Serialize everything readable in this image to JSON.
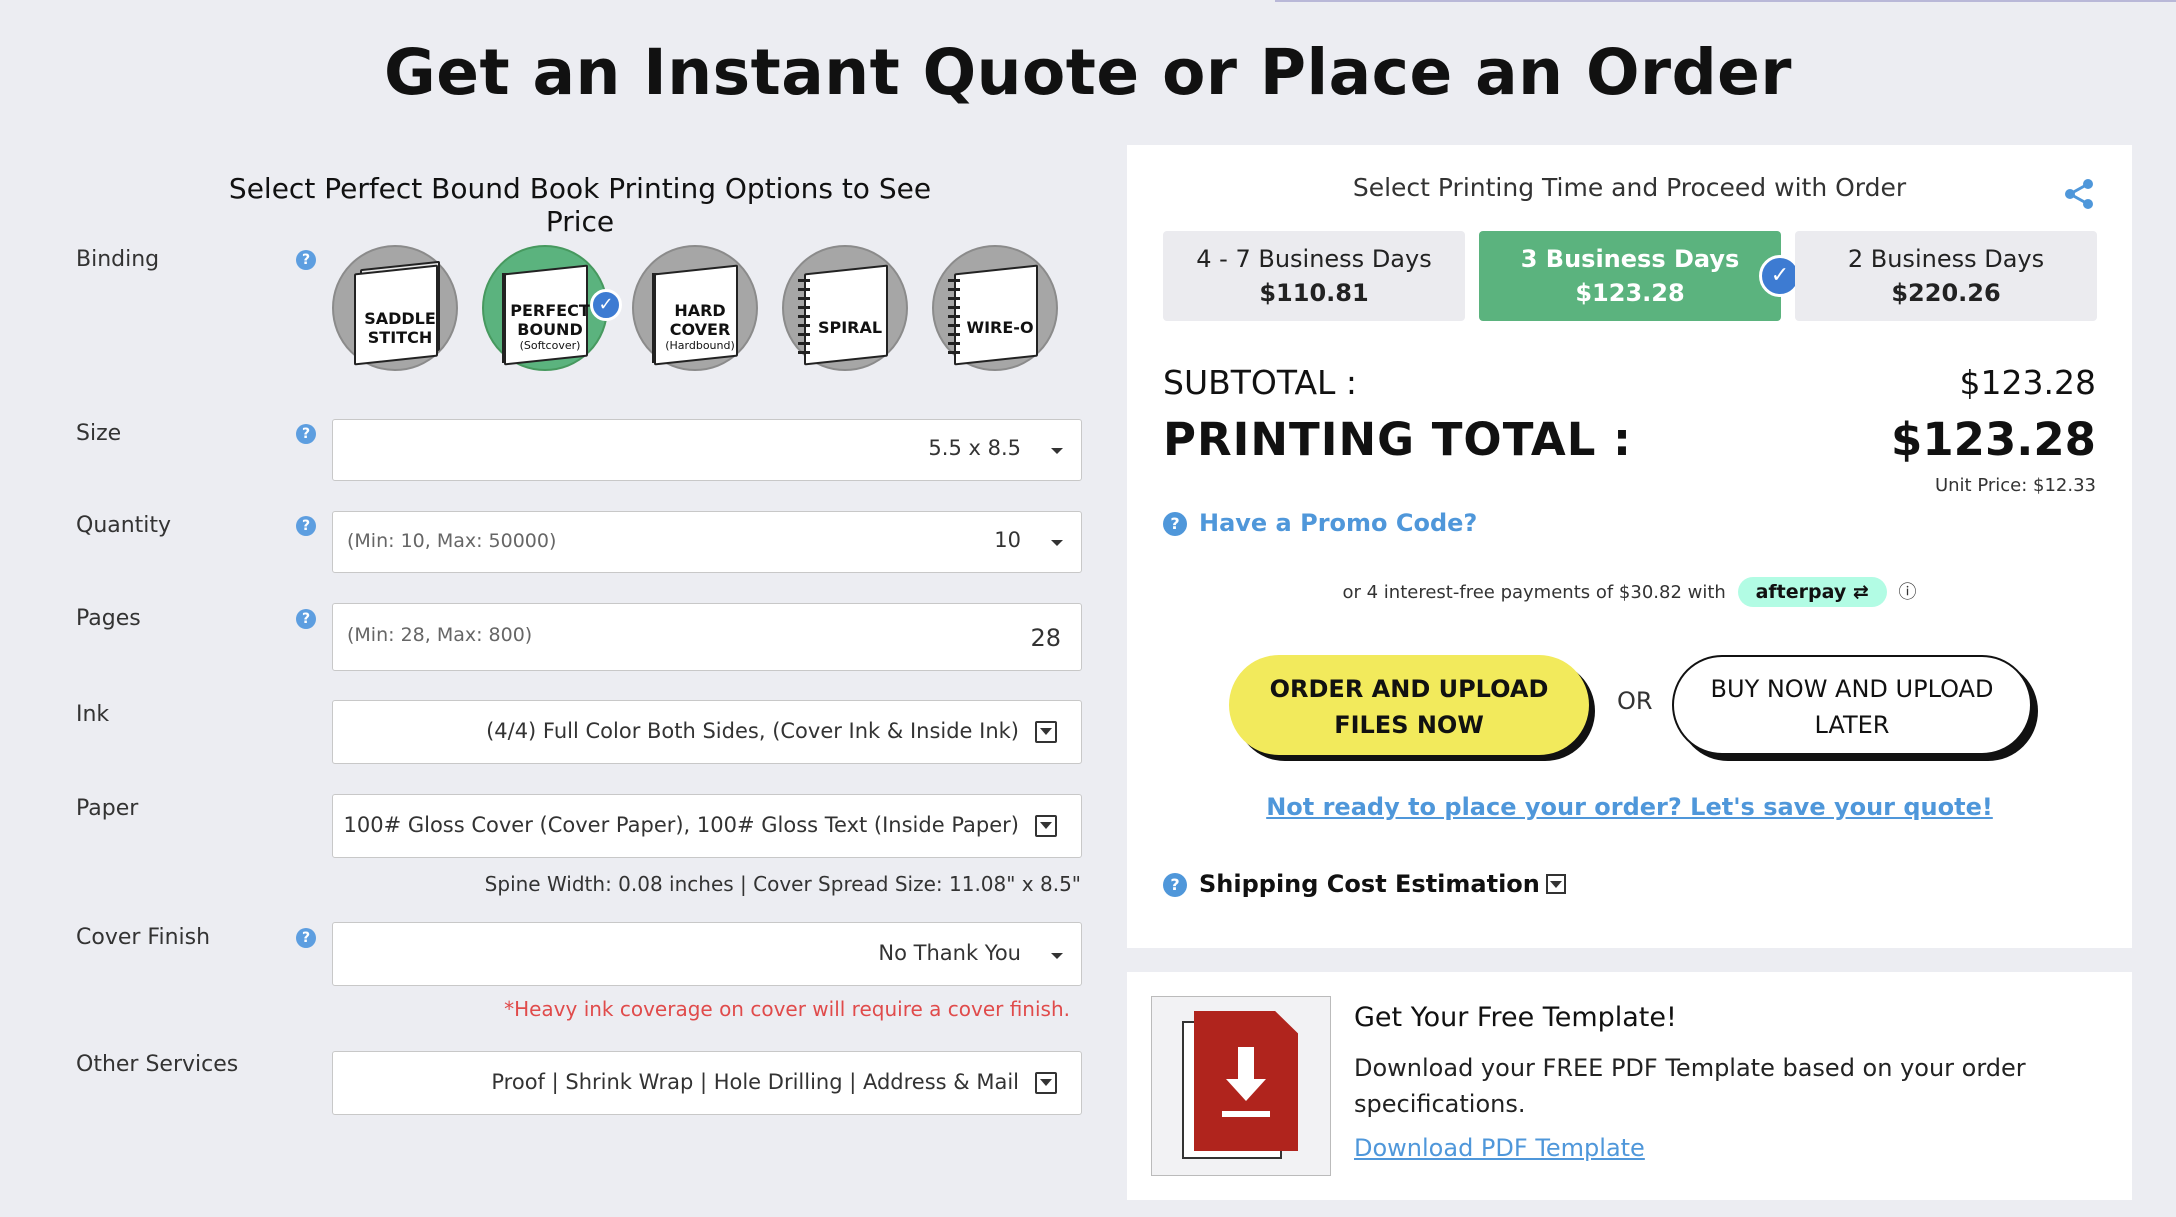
{
  "page_title": "Get an Instant Quote or Place an Order",
  "left": {
    "subtitle": "Select Perfect Bound Book Printing Options to See Price",
    "labels": {
      "binding": "Binding",
      "size": "Size",
      "quantity": "Quantity",
      "pages": "Pages",
      "ink": "Ink",
      "paper": "Paper",
      "cover_finish": "Cover Finish",
      "other_services": "Other Services"
    },
    "binding_options": [
      {
        "line1": "SADDLE",
        "line2": "STITCH",
        "small": ""
      },
      {
        "line1": "PERFECT",
        "line2": "BOUND",
        "small": "(Softcover)"
      },
      {
        "line1": "HARD",
        "line2": "COVER",
        "small": "(Hardbound)"
      },
      {
        "line1": "SPIRAL",
        "line2": "",
        "small": ""
      },
      {
        "line1": "WIRE-O",
        "line2": "",
        "small": ""
      }
    ],
    "selected_binding": "PERFECT BOUND",
    "size_value": "5.5 x 8.5",
    "quantity_placeholder": "(Min: 10, Max: 50000)",
    "quantity_value": "10",
    "pages_placeholder": "(Min: 28, Max: 800)",
    "pages_value": "28",
    "ink_value": "(4/4) Full Color Both Sides, (Cover Ink & Inside Ink)",
    "paper_value": "100# Gloss Cover (Cover Paper), 100# Gloss Text (Inside Paper)",
    "spine_info": "Spine Width: 0.08 inches | Cover Spread Size: 11.08\" x 8.5\"",
    "cover_finish_value": "No Thank You",
    "cover_finish_warning": "*Heavy ink coverage on cover will require a cover finish.",
    "other_services_value": "Proof | Shrink Wrap | Hole Drilling | Address & Mail"
  },
  "right": {
    "subtitle": "Select Printing Time and Proceed with Order",
    "time_options": [
      {
        "label": "4 - 7 Business Days",
        "price": "$110.81"
      },
      {
        "label": "3 Business Days",
        "price": "$123.28"
      },
      {
        "label": "2 Business Days",
        "price": "$220.26"
      }
    ],
    "subtotal_label": "SUBTOTAL :",
    "subtotal_value": "$123.28",
    "total_label": "PRINTING TOTAL :",
    "total_value": "$123.28",
    "unit_price": "Unit Price: $12.33",
    "promo_label": "Have a Promo Code?",
    "afterpay_prefix": "or 4 interest-free payments of $30.82 with",
    "afterpay_brand": "afterpay",
    "order_button_line1": "ORDER AND UPLOAD",
    "order_button_line2": "FILES NOW",
    "or_text": "OR",
    "buy_button_line1": "BUY NOW AND UPLOAD",
    "buy_button_line2": "LATER",
    "save_quote_link": "Not ready to place your order? Let's save your quote!",
    "shipping_label": "Shipping Cost Estimation"
  },
  "template": {
    "title": "Get Your Free Template!",
    "description": "Download your FREE PDF Template based on your order specifications.",
    "link": "Download PDF Template"
  },
  "colors": {
    "selected_green": "#5bb37e",
    "check_blue": "#3d7bd2",
    "link_blue": "#4f97da",
    "order_yellow": "#f2ea5c",
    "afterpay_mint": "#b2fce4",
    "warning_red": "#e04b4b",
    "pdf_red": "#b0241d"
  },
  "icons": [
    "help-icon",
    "share-icon",
    "check-icon",
    "dropdown-caret-icon",
    "pdf-download-icon",
    "info-icon"
  ]
}
